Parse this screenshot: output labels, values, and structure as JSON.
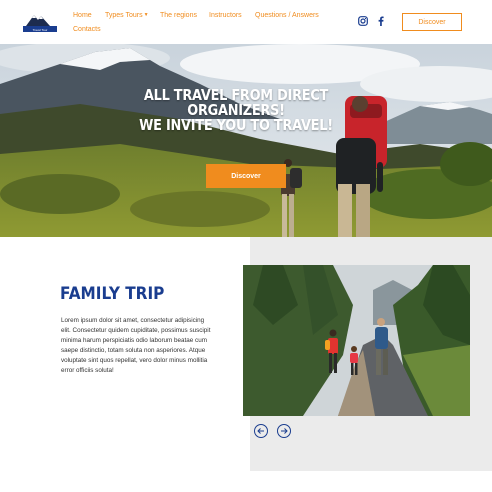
{
  "header": {
    "logo_text": "Travel Tour",
    "nav": [
      {
        "label": "Home"
      },
      {
        "label": "Types Tours"
      },
      {
        "label": "The regions"
      },
      {
        "label": "Instructors"
      },
      {
        "label": "Questions / Answers"
      },
      {
        "label": "Contacts"
      }
    ],
    "social_icons": [
      "instagram-icon",
      "facebook-icon"
    ],
    "discover_label": "Discover"
  },
  "hero": {
    "title_lines": [
      "ALL TRAVEL FROM DIRECT",
      "ORGANIZERS!",
      "WE INVITE YOU TO TRAVEL!"
    ],
    "button_label": "Discover"
  },
  "section": {
    "title": "FAMILY TRIP",
    "text": "Lorem ipsum dolor sit amet, consectetur adipisicing elit. Consectetur quidem cupiditate, possimus suscipit minima harum perspiciatis odio laborum beatae cum saepe distinctio, totam soluta non asperiores. Atque voluptate sint quos repellat, vero dolor minus mollitia error officiis soluta!"
  },
  "colors": {
    "accent": "#f08c1e",
    "brand_blue": "#1a3d8f",
    "panel_gray": "#ebebeb"
  }
}
